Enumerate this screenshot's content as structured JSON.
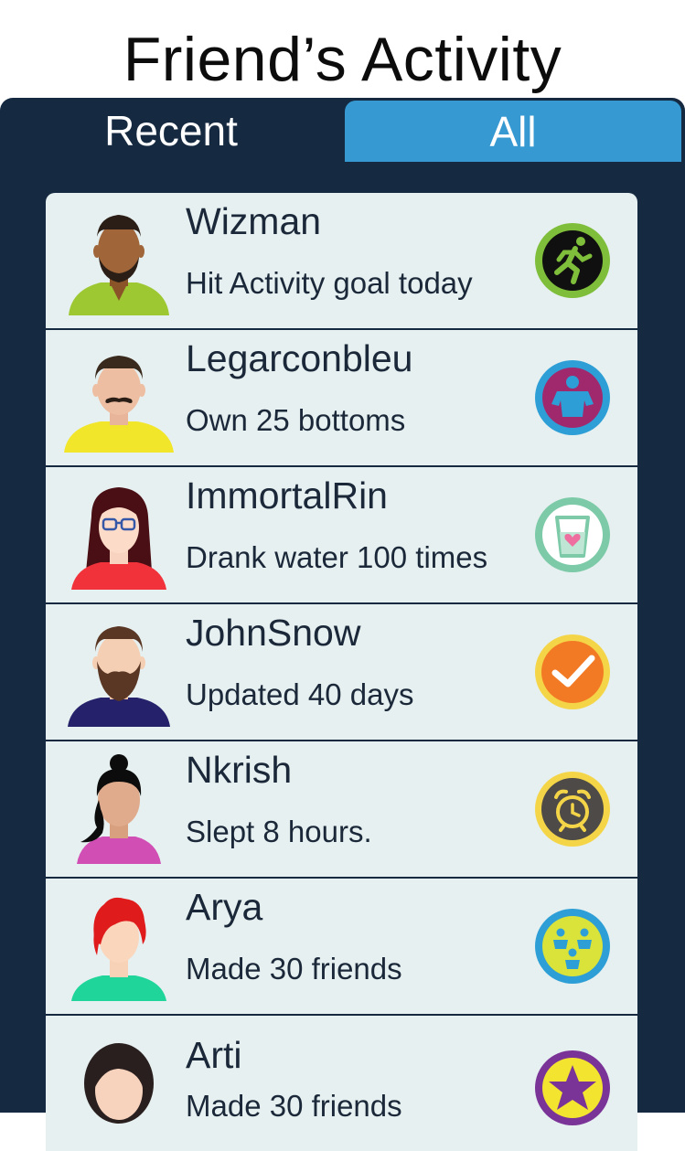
{
  "header": {
    "title": "Friend’s Activity"
  },
  "tabs": {
    "recent": "Recent",
    "all": "All"
  },
  "activities": [
    {
      "name": "Wizman",
      "activity": "Hit Activity goal today",
      "badge_icon": "running-man-icon"
    },
    {
      "name": "Legarconbleu",
      "activity": "Own 25 bottoms",
      "badge_icon": "shirt-icon"
    },
    {
      "name": "ImmortalRin",
      "activity": "Drank water 100 times",
      "badge_icon": "water-glass-icon"
    },
    {
      "name": "JohnSnow",
      "activity": "Updated 40 days",
      "badge_icon": "checkmark-icon"
    },
    {
      "name": "Nkrish",
      "activity": "Slept 8 hours.",
      "badge_icon": "alarm-clock-icon"
    },
    {
      "name": "Arya",
      "activity": "Made 30 friends",
      "badge_icon": "friends-icon"
    },
    {
      "name": "Arti",
      "activity": "Made 30 friends",
      "badge_icon": "star-icon"
    }
  ]
}
